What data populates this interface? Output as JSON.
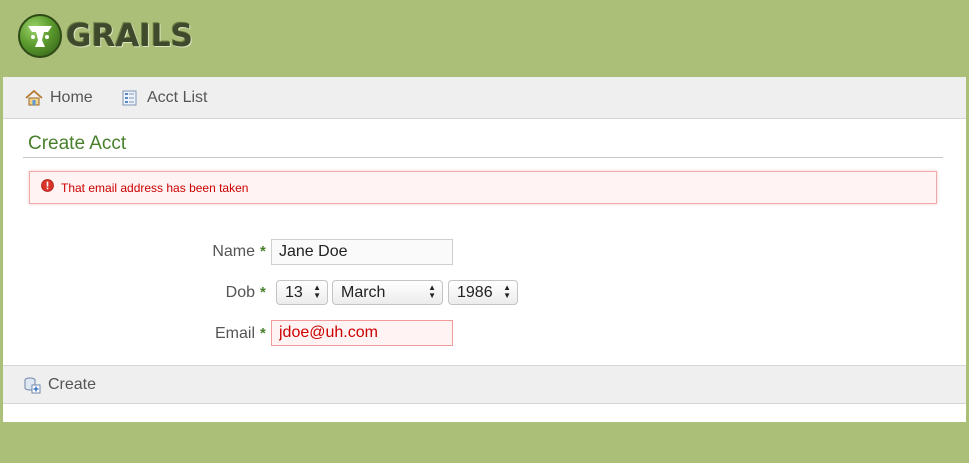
{
  "app": {
    "logo_text": "GRAILS"
  },
  "nav": {
    "home_label": "Home",
    "list_label": "Acct List"
  },
  "page": {
    "title": "Create Acct"
  },
  "error": {
    "message": "That email address has been taken"
  },
  "form": {
    "name_label": "Name",
    "name_value": "Jane Doe",
    "dob_label": "Dob",
    "dob_day": "13",
    "dob_month": "March",
    "dob_year": "1986",
    "email_label": "Email",
    "email_value": "jdoe@uh.com",
    "required_mark": "*"
  },
  "actions": {
    "create_label": "Create"
  },
  "colors": {
    "header_green": "#abbf78",
    "title_green": "#48802c",
    "error_red": "#cc0000",
    "error_bg": "#fff3f3"
  },
  "icons": {
    "logo": "grails-cup-icon",
    "home": "house-icon",
    "list": "list-document-icon",
    "error": "exclamation-circle-icon",
    "create": "database-add-icon"
  }
}
